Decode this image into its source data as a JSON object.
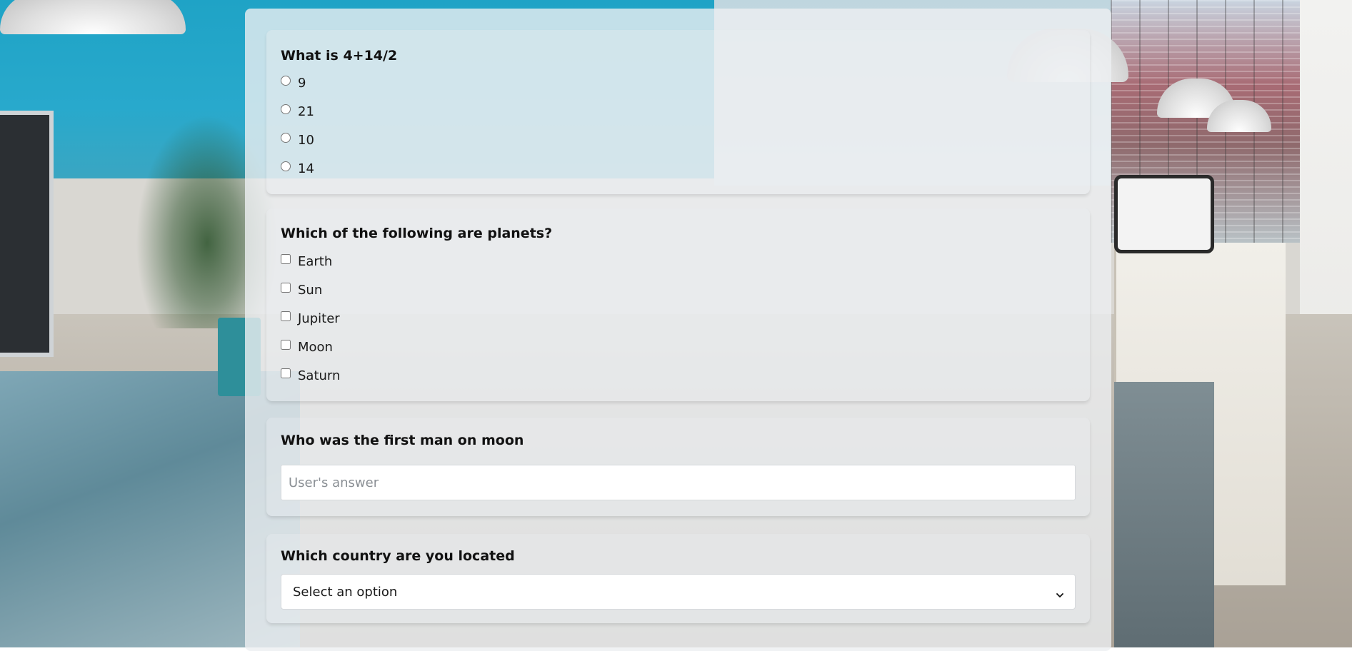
{
  "questions": {
    "q1": {
      "title": "What is 4+14/2",
      "type": "radio",
      "options": [
        "9",
        "21",
        "10",
        "14"
      ]
    },
    "q2": {
      "title": "Which of the following are planets?",
      "type": "checkbox",
      "options": [
        "Earth",
        "Sun",
        "Jupiter",
        "Moon",
        "Saturn"
      ]
    },
    "q3": {
      "title": "Who was the first man on moon",
      "type": "text",
      "value": "",
      "placeholder": "User's answer"
    },
    "q4": {
      "title": "Which country are you located",
      "type": "select",
      "selected": "Select an option"
    }
  },
  "icons": {
    "select_chevron": "chevron-down-icon"
  },
  "colors": {
    "panel": "#eceff1",
    "wall_accent": "#1fa3c6"
  }
}
